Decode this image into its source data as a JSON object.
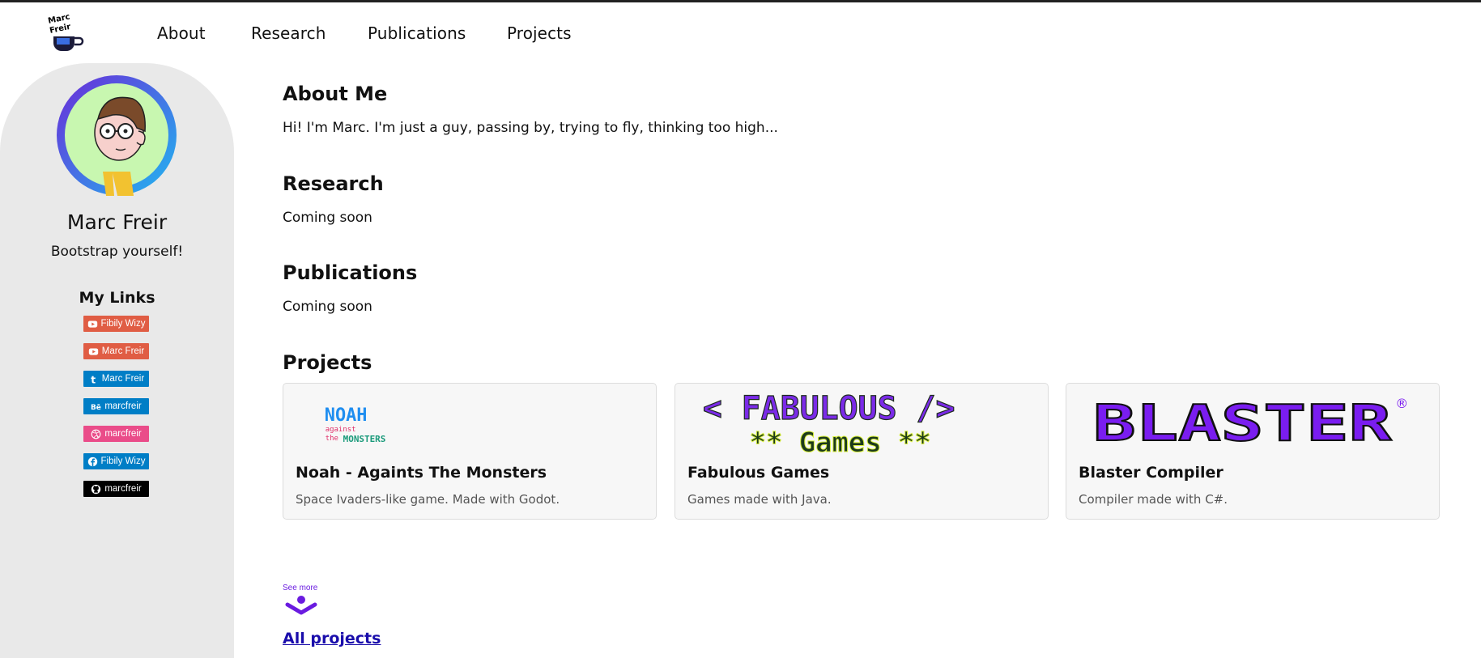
{
  "brand": {
    "logo_text": "Marc Freir"
  },
  "nav": {
    "items": [
      {
        "label": "About"
      },
      {
        "label": "Research"
      },
      {
        "label": "Publications"
      },
      {
        "label": "Projects"
      }
    ]
  },
  "sidebar": {
    "name": "Marc Freir",
    "tagline": "Bootstrap yourself!",
    "links_title": "My Links",
    "links": [
      {
        "label": "Fibily Wizy",
        "icon": "youtube-icon",
        "color": "#e05d44"
      },
      {
        "label": "Marc Freir",
        "icon": "youtube-icon",
        "color": "#e05d44"
      },
      {
        "label": "Marc Freir",
        "icon": "tumblr-icon",
        "color": "#007ec6"
      },
      {
        "label": "marcfreir",
        "icon": "behance-icon",
        "color": "#007ec6"
      },
      {
        "label": "marcfreir",
        "icon": "dribbble-icon",
        "color": "#ea4c89"
      },
      {
        "label": "Fibily Wizy",
        "icon": "facebook-icon",
        "color": "#007ec6"
      },
      {
        "label": "marcfreir",
        "icon": "github-icon",
        "color": "#000000"
      }
    ]
  },
  "about": {
    "title": "About Me",
    "text": "Hi! I'm Marc. I'm just a guy, passing by, trying to fly, thinking too high..."
  },
  "research": {
    "title": "Research",
    "text": "Coming soon"
  },
  "publications": {
    "title": "Publications",
    "text": "Coming soon"
  },
  "projects": {
    "title": "Projects",
    "cards": [
      {
        "title": "Noah - Againts The Monsters",
        "description": "Space Ivaders-like game. Made with Godot.",
        "logo_line1": "NOAH",
        "logo_line2": "against",
        "logo_line3": "the",
        "logo_line4": "MONSTERS"
      },
      {
        "title": "Fabulous Games",
        "description": "Games made with Java.",
        "logo_line1": "< FABULOUS />",
        "logo_line2": "** Games **"
      },
      {
        "title": "Blaster Compiler",
        "description": "Compiler made with C#.",
        "logo_line1": "BLASTER",
        "logo_mark": "®"
      }
    ],
    "see_more_label": "See more",
    "all_projects_label": "All projects"
  },
  "colors": {
    "accent": "#6a1be0",
    "sidebar_bg": "#e9e9e9",
    "link": "#1a0dab"
  }
}
